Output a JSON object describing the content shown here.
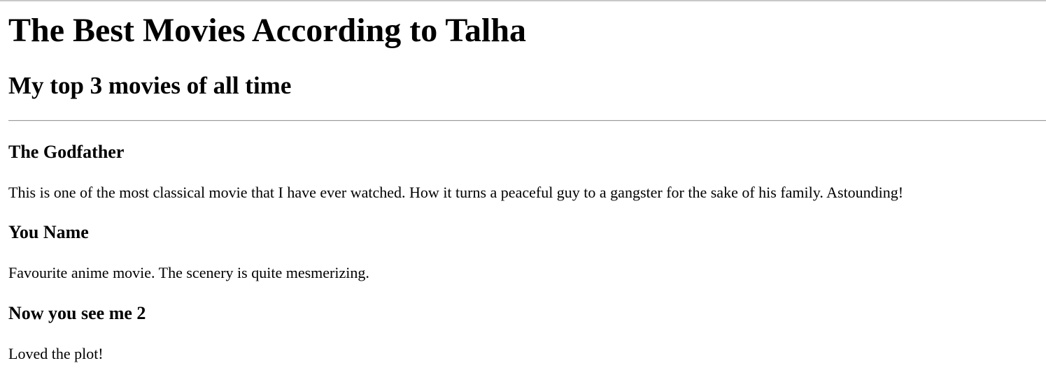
{
  "header": {
    "title": "The Best Movies According to Talha",
    "subtitle": "My top 3 movies of all time"
  },
  "movies": [
    {
      "title": "The Godfather",
      "description": "This is one of the most classical movie that I have ever watched. How it turns a peaceful guy to a gangster for the sake of his family. Astounding!"
    },
    {
      "title": "You Name",
      "description": "Favourite anime movie. The scenery is quite mesmerizing."
    },
    {
      "title": "Now you see me 2",
      "description": "Loved the plot!"
    }
  ]
}
